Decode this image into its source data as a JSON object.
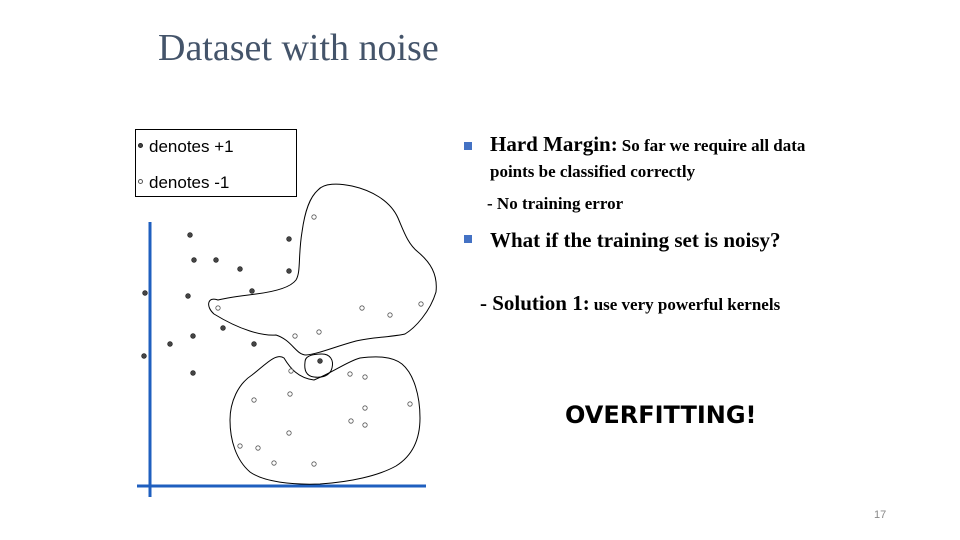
{
  "title": "Dataset with noise",
  "legend": {
    "positive": "denotes +1",
    "negative": "denotes -1"
  },
  "bullets": {
    "hard_margin_label": "Hard Margin:",
    "hard_margin_text": "So far we require all data points be classified correctly",
    "no_training_error": "- No training error",
    "noisy_question": "What if the training set is noisy?",
    "solution_label": "- Solution 1:",
    "solution_text": "use very powerful kernels"
  },
  "overfitting": "OVERFITTING!",
  "page_number": "17",
  "colors": {
    "title": "#44546a",
    "bullet_square": "#4472c4",
    "axis": "#1f5fbf"
  }
}
